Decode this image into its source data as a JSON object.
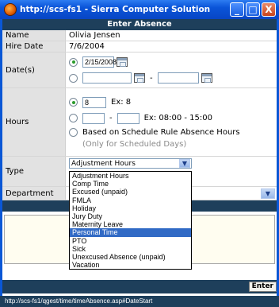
{
  "window": {
    "title": "http://scs-fs1 - Sierra Computer Solution...",
    "buttons": [
      "_",
      "□",
      "X"
    ]
  },
  "form": {
    "header": "Enter Absence",
    "name_label": "Name",
    "name_value": "Olivia Jensen",
    "hire_label": "Hire Date",
    "hire_value": "7/6/2004",
    "dates_label": "Date(s)",
    "date_single": "2/15/2008",
    "date_range_start": "",
    "date_range_end": "",
    "range_dash": "-",
    "hours_label": "Hours",
    "hours_value": "8",
    "hours_example": "Ex: 8",
    "hours_range_start": "",
    "hours_range_end": "",
    "hours_range_example": "Ex: 08:00 - 15:00",
    "schedule_label": "Based on Schedule Rule Absence Hours",
    "schedule_note": "(Only for Scheduled Days)",
    "type_label": "Type",
    "type_selected": "Adjustment Hours",
    "department_label": "Department",
    "type_options": [
      "Adjustment Hours",
      "Comp Time",
      "Excused (unpaid)",
      "FMLA",
      "Holiday",
      "Jury Duty",
      "Maternity Leave",
      "Personal Time",
      "PTO",
      "Sick",
      "Unexcused Absence (unpaid)",
      "Vacation"
    ],
    "highlighted_option": "Personal Time",
    "enter_button": "Enter"
  },
  "status_bar": "http://scs-fs1/qgest/time/timeAbsence.asp#DateStart",
  "colors": {
    "titlebar": "#0a54d8",
    "header": "#1e3f5b",
    "label_bg": "#e2e2e2",
    "highlight": "#316ac5"
  }
}
